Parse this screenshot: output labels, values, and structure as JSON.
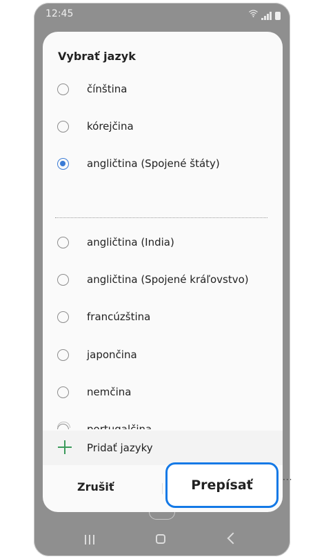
{
  "status_bar": {
    "time": "12:45"
  },
  "dialog": {
    "title": "Vybrať jazyk",
    "languages": [
      {
        "label": "čínština",
        "selected": false
      },
      {
        "label": "kórejčina",
        "selected": false
      },
      {
        "label": "angličtina (Spojené štáty)",
        "selected": true
      },
      {
        "label": "angličtina (India)",
        "selected": false
      },
      {
        "label": "angličtina (Spojené kráľovstvo)",
        "selected": false
      },
      {
        "label": "francúzština",
        "selected": false
      },
      {
        "label": "japončina",
        "selected": false
      },
      {
        "label": "nemčina",
        "selected": false
      },
      {
        "label": "portugalčina",
        "selected": false
      }
    ],
    "add_languages_label": "Pridať jazyky",
    "cancel_label": "Zrušiť",
    "overwrite_label": "Prepísať"
  },
  "colors": {
    "accent": "#3a7bd5",
    "highlight_border": "#1479e6",
    "add_icon": "#3a9a5a",
    "scrim": "#8f8f8f"
  },
  "icons": [
    "wifi-icon",
    "signal-icon",
    "battery-icon",
    "radio-icon",
    "plus-icon",
    "recent-apps-icon",
    "home-icon",
    "back-icon"
  ]
}
